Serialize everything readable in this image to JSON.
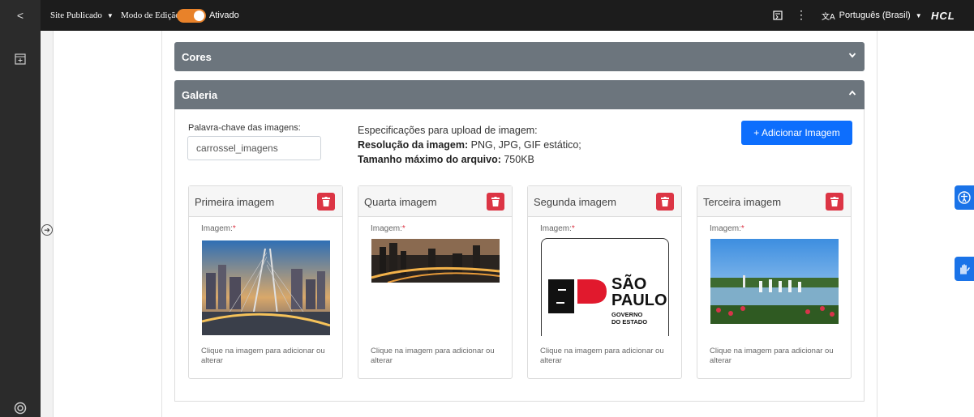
{
  "topbar": {
    "back_glyph": "<",
    "site_status": "Site Publicado",
    "edit_mode_label": "Modo de Edição:",
    "edit_mode_value": "Ativado",
    "language": "Português (Brasil)",
    "brand": "HCL"
  },
  "sections": {
    "cores_title": "Cores",
    "galeria_title": "Galeria"
  },
  "gallery": {
    "keyword_label": "Palavra-chave das imagens:",
    "keyword_value": "carrossel_imagens",
    "spec_title": "Especificações para upload de imagem:",
    "resolution_label": "Resolução da imagem:",
    "resolution_value": " PNG, JPG, GIF estático;",
    "maxsize_label": "Tamanho máximo do arquivo:",
    "maxsize_value": " 750KB",
    "add_button": "+ Adicionar Imagem",
    "cards": [
      {
        "title": "Primeira imagem",
        "image_label": "Imagem:",
        "required": "*",
        "hint": "Clique na imagem para adicionar ou alterar"
      },
      {
        "title": "Quarta imagem",
        "image_label": "Imagem:",
        "required": "*",
        "hint": "Clique na imagem para adicionar ou alterar"
      },
      {
        "title": "Segunda imagem",
        "image_label": "Imagem:",
        "required": "*",
        "hint": "Clique na imagem para adicionar ou alterar"
      },
      {
        "title": "Terceira imagem",
        "image_label": "Imagem:",
        "required": "*",
        "hint": "Clique na imagem para adicionar ou alterar"
      }
    ],
    "logo": {
      "line1": "SÃO",
      "line2": "PAULO",
      "line3": "GOVERNO",
      "line4": "DO ESTADO"
    }
  },
  "colors": {
    "accent": "#0d6efd",
    "danger": "#dc3545",
    "header_gray": "#6c757d",
    "toggle": "#e8822a"
  }
}
